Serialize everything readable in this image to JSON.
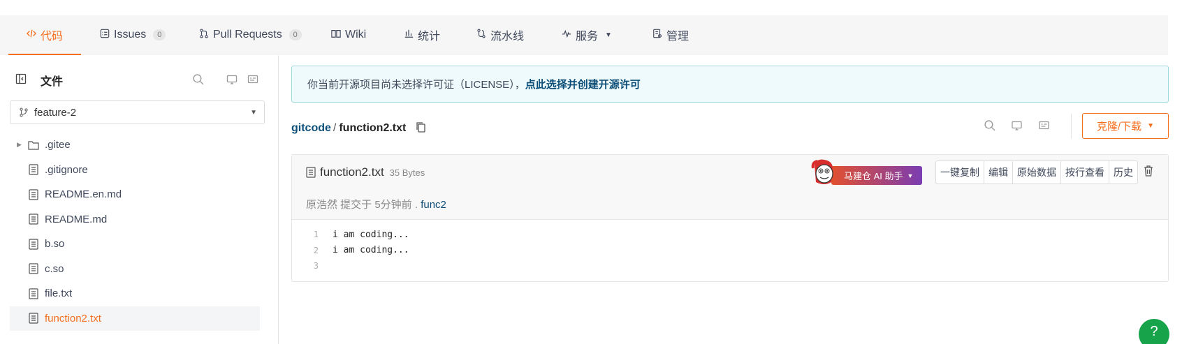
{
  "tabs": [
    {
      "label": "代码",
      "icon": "code-icon",
      "active": true
    },
    {
      "label": "Issues",
      "icon": "issues-icon",
      "count": "0"
    },
    {
      "label": "Pull Requests",
      "icon": "pull-request-icon",
      "count": "0"
    },
    {
      "label": "Wiki",
      "icon": "book-icon"
    },
    {
      "label": "统计",
      "icon": "bar-chart-icon"
    },
    {
      "label": "流水线",
      "icon": "pipeline-icon"
    },
    {
      "label": "服务",
      "icon": "pulse-icon"
    },
    {
      "label": "管理",
      "icon": "manage-icon"
    }
  ],
  "sidebar": {
    "title": "文件",
    "branch": "feature-2",
    "items": [
      {
        "label": ".gitee",
        "type": "folder"
      },
      {
        "label": ".gitignore",
        "type": "file"
      },
      {
        "label": "README.en.md",
        "type": "file"
      },
      {
        "label": "README.md",
        "type": "file"
      },
      {
        "label": "b.so",
        "type": "file"
      },
      {
        "label": "c.so",
        "type": "file"
      },
      {
        "label": "file.txt",
        "type": "file"
      },
      {
        "label": "function2.txt",
        "type": "file",
        "active": true
      }
    ]
  },
  "license": {
    "text": "你当前开源项目尚未选择许可证（LICENSE），",
    "link": "点此选择并创建开源许可"
  },
  "breadcrumb": {
    "repo": "gitcode",
    "sep": "/",
    "file": "function2.txt"
  },
  "clone_label": "克隆/下载",
  "file": {
    "name": "function2.txt",
    "size": "35 Bytes",
    "commit_text": "原浩然 提交于 5分钟前 .",
    "commit_msg": "func2",
    "ai_label": "马建仓 AI 助手",
    "buttons": [
      "一键复制",
      "编辑",
      "原始数据",
      "按行查看",
      "历史"
    ],
    "lines": [
      {
        "no": "1",
        "text": "i am coding..."
      },
      {
        "no": "2",
        "text": "i am coding..."
      },
      {
        "no": "3",
        "text": ""
      }
    ]
  },
  "help_label": "?",
  "colors": {
    "accent": "#f56e1e",
    "link": "#0c4e78",
    "help": "#17a34a"
  }
}
